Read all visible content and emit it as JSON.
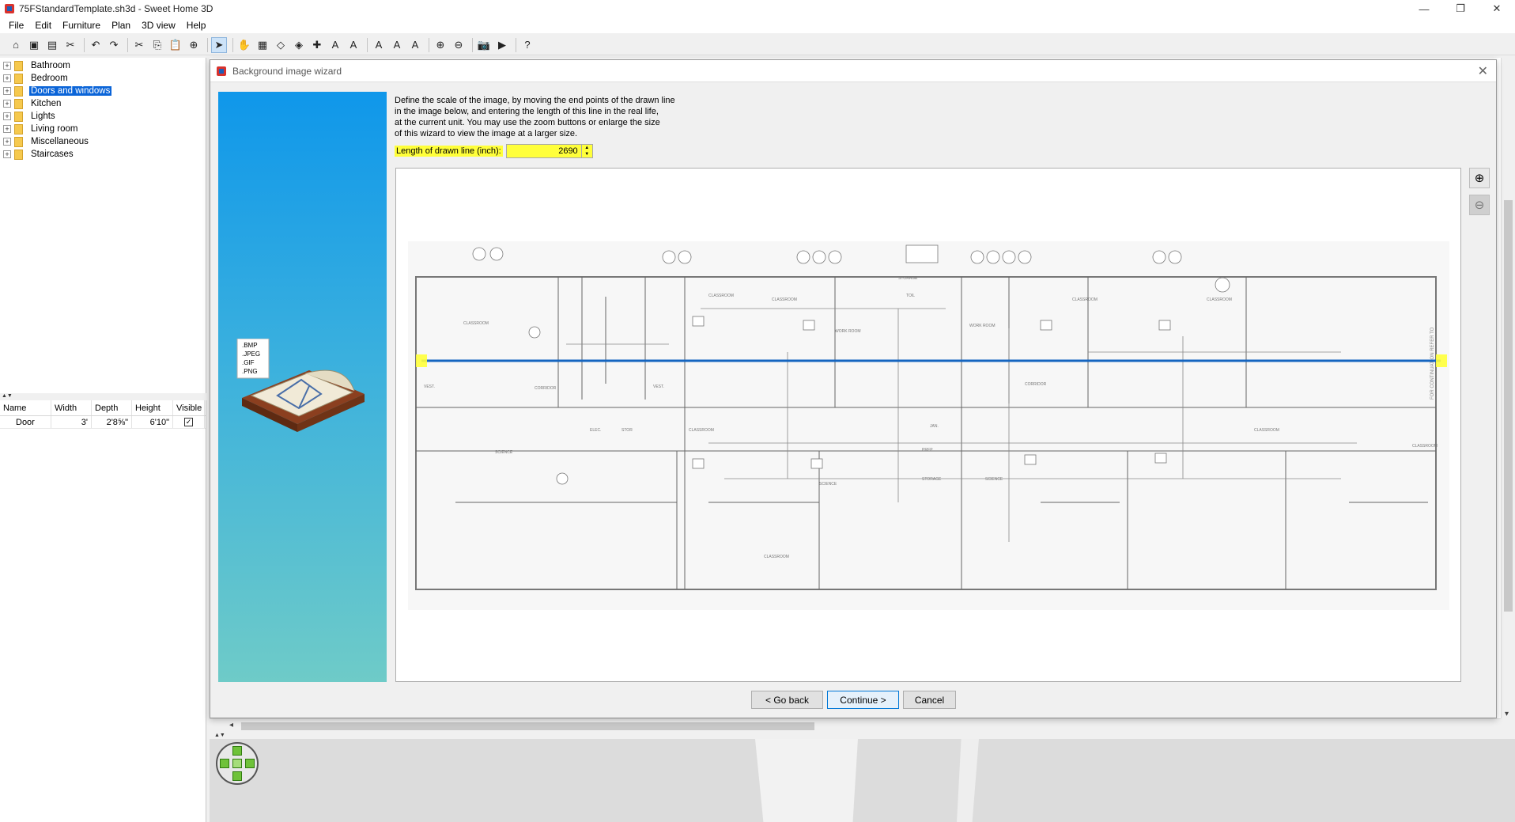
{
  "window": {
    "title": "75FStandardTemplate.sh3d - Sweet Home 3D",
    "minimize": "—",
    "maximize": "❐",
    "close": "✕"
  },
  "menu": [
    "File",
    "Edit",
    "Furniture",
    "Plan",
    "3D view",
    "Help"
  ],
  "toolbar": {
    "icons": [
      "new-home-icon",
      "open-icon",
      "save-icon",
      "cut-tool-icon",
      "undo-icon",
      "redo-icon",
      "cut-icon",
      "copy-icon",
      "paste-icon",
      "add-furniture-icon",
      "select-icon",
      "pan-icon",
      "create-walls-icon",
      "create-rooms-icon",
      "create-polylines-icon",
      "create-dimensions-icon",
      "add-text-icon",
      "increase-text-icon",
      "decrease-text-icon",
      "bold-icon",
      "italic-icon",
      "zoom-in-icon",
      "zoom-out-icon",
      "photo-icon",
      "video-icon",
      "help-icon"
    ],
    "glyphs": [
      "⌂",
      "▣",
      "▤",
      "✂",
      "↶",
      "↷",
      "✂",
      "⎘",
      "📋",
      "⊕",
      "➤",
      "✋",
      "▦",
      "◇",
      "◈",
      "✚",
      "A",
      "A",
      "A",
      "A",
      "A",
      "⊕",
      "⊖",
      "📷",
      "▶",
      "?"
    ]
  },
  "catalog": {
    "categories": [
      "Bathroom",
      "Bedroom",
      "Doors and windows",
      "Kitchen",
      "Lights",
      "Living room",
      "Miscellaneous",
      "Staircases"
    ],
    "selected_index": 2
  },
  "furniture_table": {
    "headers": [
      "Name",
      "Width",
      "Depth",
      "Height",
      "Visible"
    ],
    "rows": [
      {
        "name": "Door",
        "width": "3'",
        "depth": "2'8⅝\"",
        "height": "6'10\"",
        "visible": true
      }
    ]
  },
  "dialog": {
    "title": "Background image wizard",
    "close": "✕",
    "wizard_formats": [
      ".BMP",
      ".JPEG",
      ".GIF",
      ".PNG"
    ],
    "instructions": [
      "Define the scale of the image, by moving the end points of the drawn line",
      "in the image below, and entering the length of this line in the real life,",
      "at the current unit. You may use the zoom buttons or enlarge the size",
      "of this wizard to view the image at a larger size."
    ],
    "length_label": "Length of drawn line (inch):",
    "length_value": "2690",
    "plan_labels": [
      "CLASSROOM",
      "CLASSROOM",
      "CLASSROOM",
      "CLASSROOM",
      "CLASSROOM",
      "CLASSROOM",
      "CLASSROOM",
      "CLASSROOM",
      "CLASSROOM",
      "CORRIDOR",
      "CORRIDOR",
      "SCIENCE",
      "SCIENCE",
      "SCIENCE",
      "STORAGE",
      "STORAGE",
      "WORK ROOM",
      "WORK ROOM",
      "VEST.",
      "VEST.",
      "TOIL",
      "JAN.",
      "PREP",
      "ELEC.",
      "STOR",
      "FOR CONTINUATION REFER TO"
    ],
    "buttons": {
      "back": "< Go back",
      "continue": "Continue >",
      "cancel": "Cancel"
    }
  },
  "colors": {
    "selection": "#0a64d8",
    "highlight": "#ffff3a",
    "scale_line": "#1565c0",
    "wizard_top": "#0f97ea",
    "wizard_bottom": "#6ecbc8"
  }
}
